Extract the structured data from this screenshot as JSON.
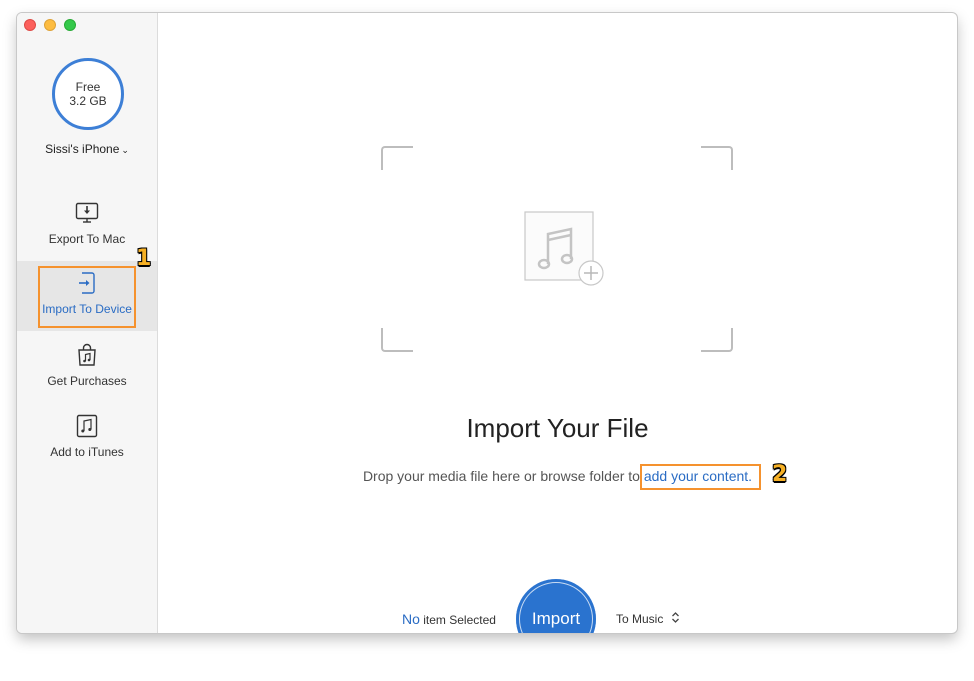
{
  "sidebar": {
    "storage": {
      "line1": "Free",
      "line2": "3.2 GB"
    },
    "device": {
      "name": "Sissi's iPhone",
      "chevron": "⌄"
    },
    "items": [
      {
        "label": "Export To Mac",
        "icon": "monitor-download-icon",
        "active": false
      },
      {
        "label": "Import To Device",
        "icon": "import-arrow-icon",
        "active": true
      },
      {
        "label": "Get Purchases",
        "icon": "shopping-bag-music-icon",
        "active": false
      },
      {
        "label": "Add to iTunes",
        "icon": "music-note-icon",
        "active": false
      }
    ]
  },
  "callouts": {
    "one": "1",
    "two": "2"
  },
  "main": {
    "placeholder_icon": "music-add-icon",
    "headline": "Import Your File",
    "subline_prefix": "Drop your media file here or browse folder to ",
    "subline_link": "add your content."
  },
  "footer": {
    "selected_count": "No",
    "selected_suffix": " item Selected",
    "import_label": "Import",
    "target_label": "To Music",
    "target_icon": "updown-chevron-icon"
  },
  "colors": {
    "accent": "#2a73cf",
    "callout": "#f5922e",
    "storage_ring": "#3d7fd6"
  }
}
